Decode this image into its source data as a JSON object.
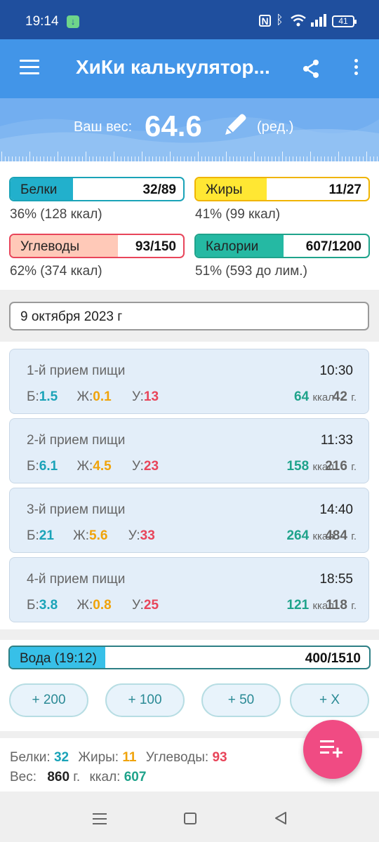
{
  "status_bar": {
    "time": "19:14",
    "battery": "41"
  },
  "app_bar": {
    "title": "ХиКи калькулятор..."
  },
  "header": {
    "weight_label": "Ваш вес:",
    "weight_value": "64.6",
    "edit_label": "(ред.)"
  },
  "macros": {
    "protein": {
      "name": "Белки",
      "count": "32/89",
      "sub": "36% (128 ккал)",
      "fraction": 0.36,
      "color": "#1aa3b8",
      "fill": "#22b0cc"
    },
    "fat": {
      "name": "Жиры",
      "count": "11/27",
      "sub": "41% (99 ккал)",
      "fraction": 0.41,
      "color": "#f0b400",
      "fill": "#ffe733"
    },
    "carbs": {
      "name": "Углеводы",
      "count": "93/150",
      "sub": "62% (374 ккал)",
      "fraction": 0.62,
      "color": "#e8455a",
      "fill": "#ffc9b8"
    },
    "calories": {
      "name": "Калории",
      "count": "607/1200",
      "sub": "51% (593 до лим.)",
      "fraction": 0.51,
      "color": "#1fa38b",
      "fill": "#25b9a3"
    }
  },
  "date": "9 октября 2023 г",
  "meals": [
    {
      "title": "1-й прием пищи",
      "time": "10:30",
      "b_label": "Б:",
      "b": "1.5",
      "f_label": "Ж:",
      "f": "0.1",
      "u_label": "У:",
      "u": "13",
      "kcal": "64",
      "kcal_unit": "ккал",
      "grams": "42",
      "grams_unit": "г."
    },
    {
      "title": "2-й прием пищи",
      "time": "11:33",
      "b_label": "Б:",
      "b": "6.1",
      "f_label": "Ж:",
      "f": "4.5",
      "u_label": "У:",
      "u": "23",
      "kcal": "158",
      "kcal_unit": "ккал",
      "grams": "216",
      "grams_unit": "г."
    },
    {
      "title": "3-й прием пищи",
      "time": "14:40",
      "b_label": "Б:",
      "b": "21",
      "f_label": "Ж:",
      "f": "5.6",
      "u_label": "У:",
      "u": "33",
      "kcal": "264",
      "kcal_unit": "ккал",
      "grams": "484",
      "grams_unit": "г."
    },
    {
      "title": "4-й прием пищи",
      "time": "18:55",
      "b_label": "Б:",
      "b": "3.8",
      "f_label": "Ж:",
      "f": "0.8",
      "u_label": "У:",
      "u": "25",
      "kcal": "121",
      "kcal_unit": "ккал",
      "grams": "118",
      "grams_unit": "г."
    }
  ],
  "water": {
    "name": "Вода (19:12)",
    "count": "400/1510",
    "fraction": 0.265,
    "buttons": [
      "+ 200",
      "+ 100",
      "+ 50",
      "+ X"
    ]
  },
  "summary": {
    "protein_label": "Белки:",
    "protein": "32",
    "fat_label": "Жиры:",
    "fat": "11",
    "carbs_label": "Углеводы:",
    "carbs": "93",
    "weight_label": "Вес:",
    "weight": "860",
    "weight_unit": "г.",
    "kcal_label": "ккал:",
    "kcal": "607"
  },
  "icons": {
    "menu": "menu-icon",
    "share": "share-icon",
    "more": "more-vert-icon",
    "edit": "pencil-icon",
    "fab": "add-to-list-icon"
  }
}
